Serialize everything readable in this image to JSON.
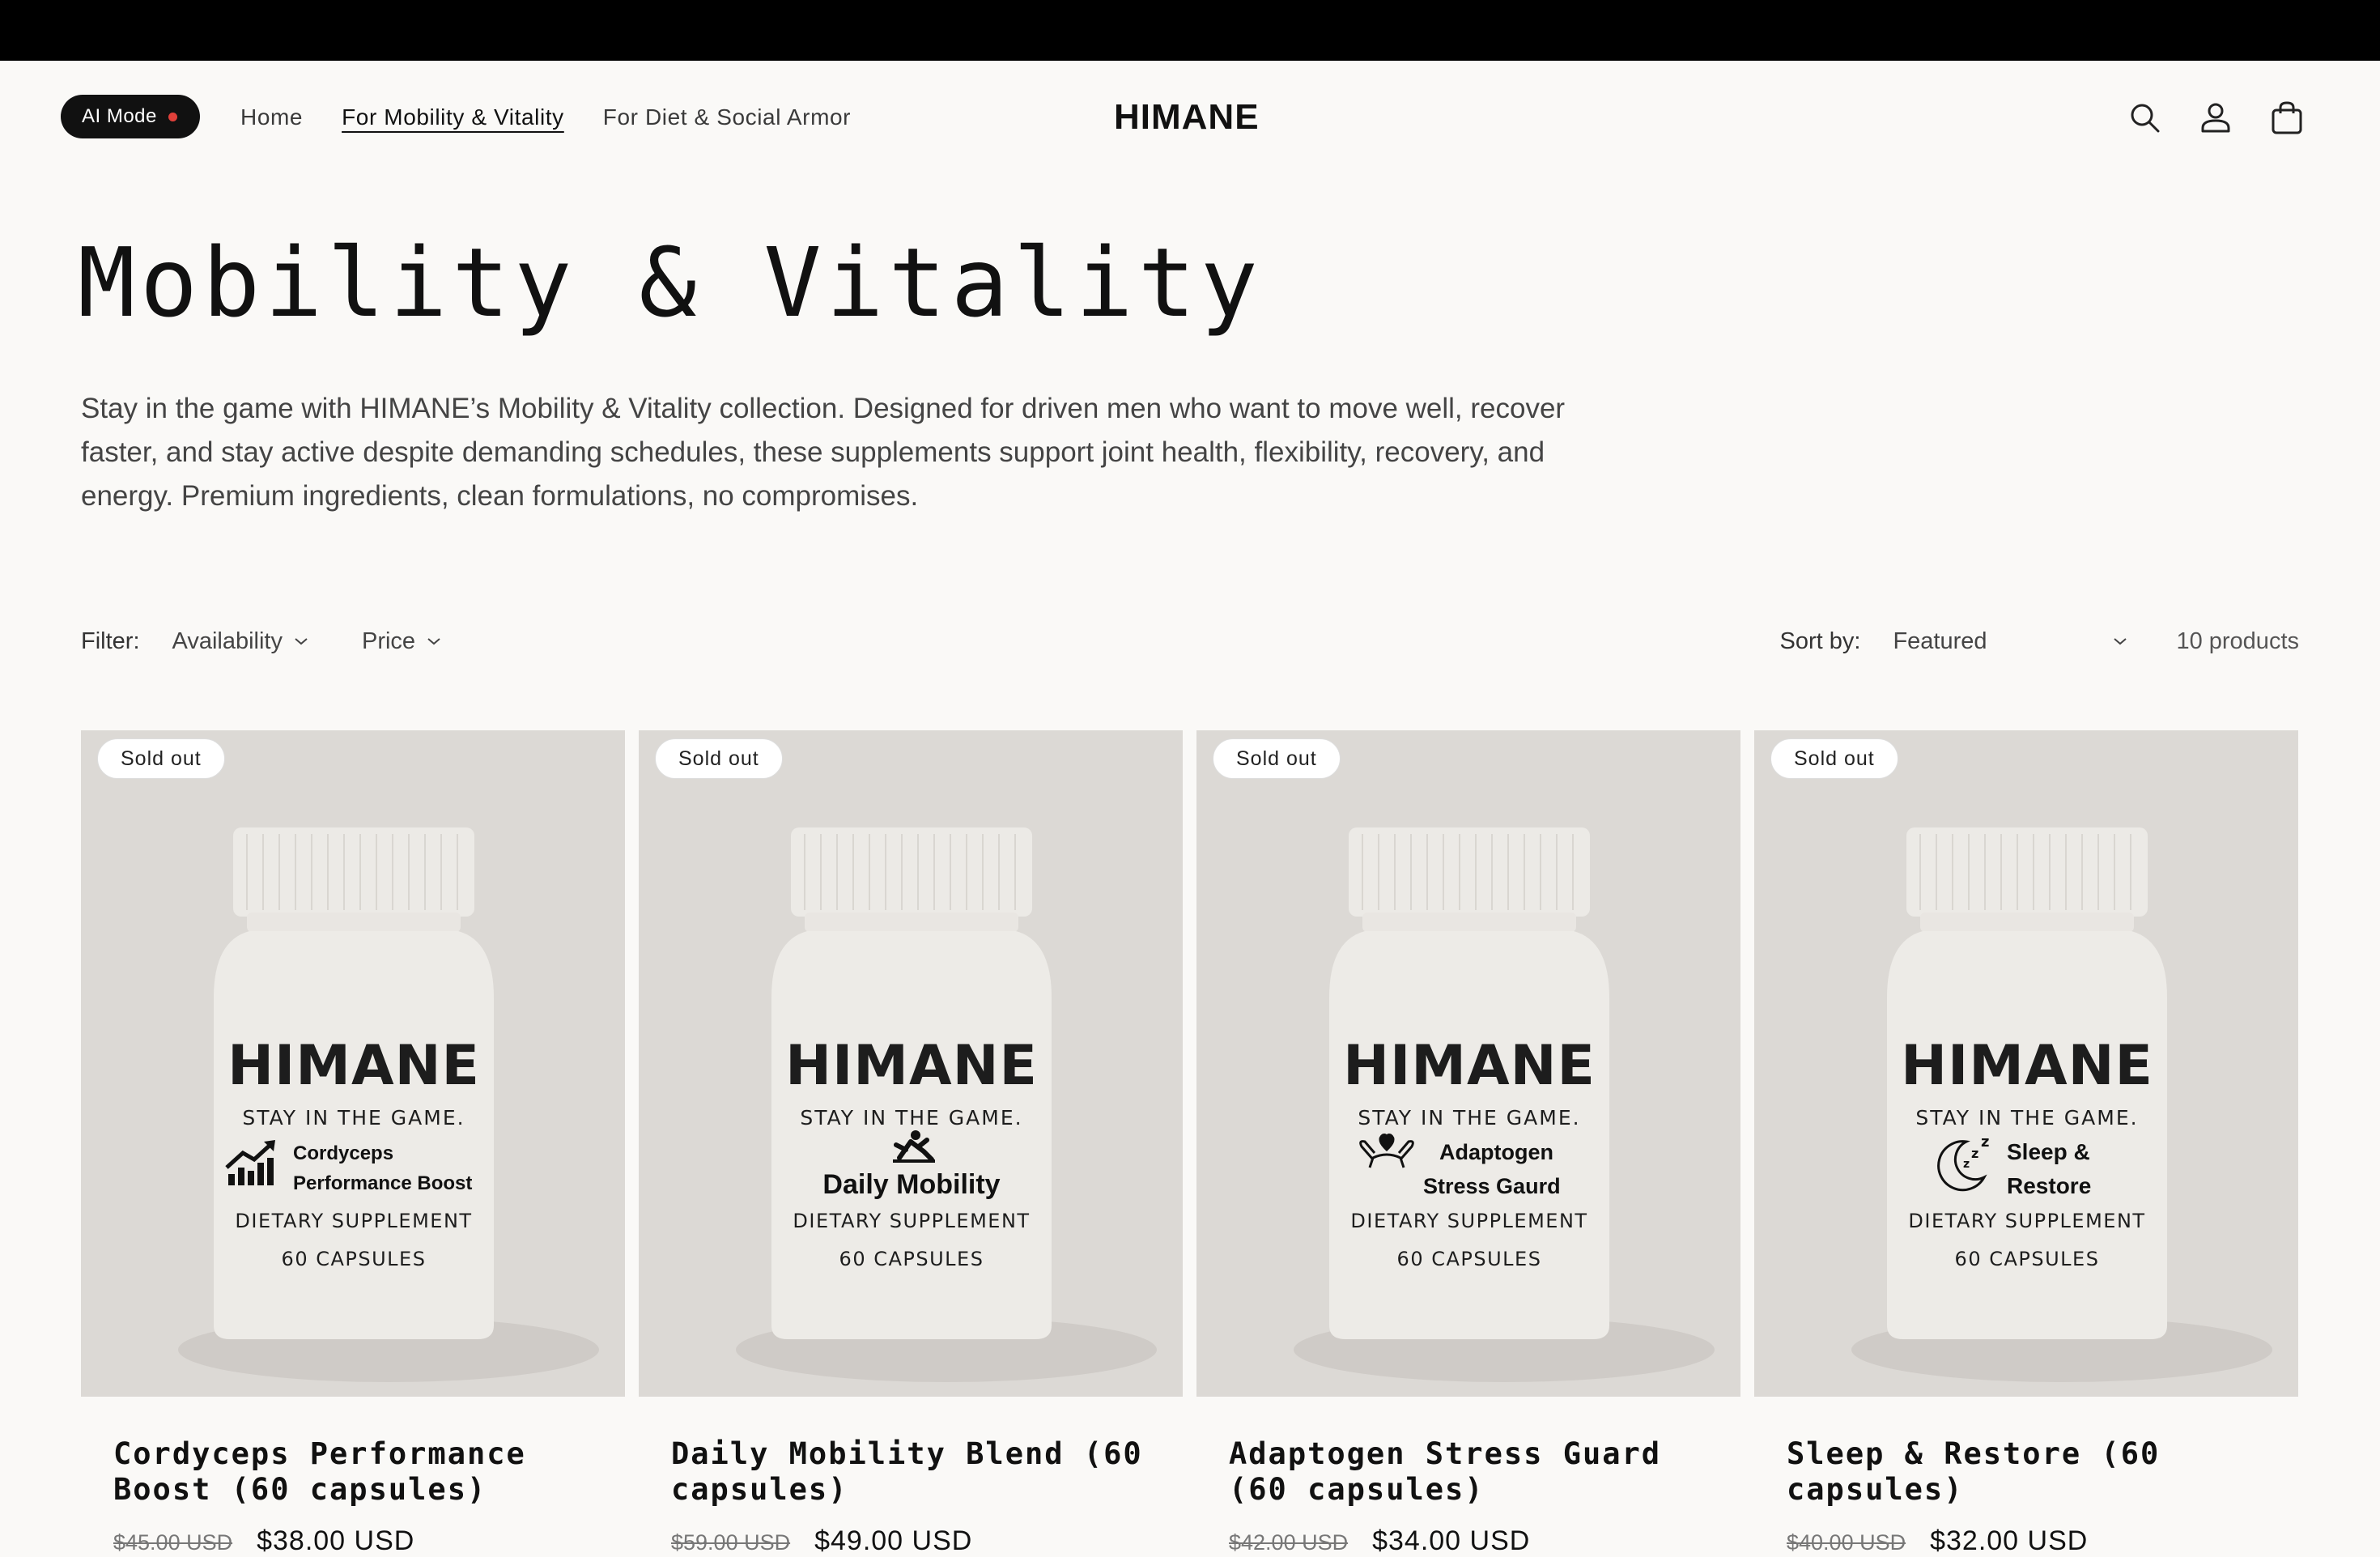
{
  "header": {
    "ai_mode_label": "AI Mode",
    "nav": [
      {
        "label": "Home"
      },
      {
        "label": "For Mobility & Vitality"
      },
      {
        "label": "For Diet & Social Armor"
      }
    ],
    "logo": "HIMANE",
    "icons": [
      "search-icon",
      "account-icon",
      "cart-icon"
    ]
  },
  "page": {
    "title": "Mobility & Vitality",
    "description": "Stay in the game with HIMANE’s Mobility & Vitality collection. Designed for driven men who want to move well, recover faster, and stay active despite demanding schedules, these supplements support joint health, flexibility, recovery, and energy. Premium ingredients, clean formulations, no compromises."
  },
  "filters": {
    "label": "Filter:",
    "availability": "Availability",
    "price": "Price",
    "sort_label": "Sort by:",
    "sort_value": "Featured",
    "count": "10 products"
  },
  "products": [
    {
      "badge": "Sold out",
      "bottle": {
        "brand": "HIMANE",
        "tagline": "STAY IN THE GAME.",
        "line1": "Cordyceps",
        "line2": "Performance Boost",
        "supplement": "DIETARY SUPPLEMENT",
        "capsules": "60 CAPSULES",
        "icon": "chart-growth-icon"
      },
      "title": "Cordyceps Performance Boost (60 capsules)",
      "old_price": "$45.00 USD",
      "price": "$38.00 USD"
    },
    {
      "badge": "Sold out",
      "bottle": {
        "brand": "HIMANE",
        "tagline": "STAY IN THE GAME.",
        "line1": "Daily Mobility",
        "line2": "",
        "supplement": "DIETARY SUPPLEMENT",
        "capsules": "60 CAPSULES",
        "icon": "stretch-figure-icon"
      },
      "title": "Daily Mobility Blend (60 capsules)",
      "old_price": "$59.00 USD",
      "price": "$49.00 USD"
    },
    {
      "badge": "Sold out",
      "bottle": {
        "brand": "HIMANE",
        "tagline": "STAY IN THE GAME.",
        "line1": "Adaptogen",
        "line2": "Stress Gaurd",
        "supplement": "DIETARY SUPPLEMENT",
        "capsules": "60 CAPSULES",
        "icon": "hands-heart-icon"
      },
      "title": "Adaptogen Stress Guard (60 capsules)",
      "old_price": "$42.00 USD",
      "price": "$34.00 USD"
    },
    {
      "badge": "Sold out",
      "bottle": {
        "brand": "HIMANE",
        "tagline": "STAY IN THE GAME.",
        "line1": "Sleep &",
        "line2": "Restore",
        "supplement": "DIETARY SUPPLEMENT",
        "capsules": "60 CAPSULES",
        "icon": "moon-sleep-icon"
      },
      "title": "Sleep & Restore (60 capsules)",
      "old_price": "$40.00 USD",
      "price": "$32.00 USD"
    }
  ]
}
